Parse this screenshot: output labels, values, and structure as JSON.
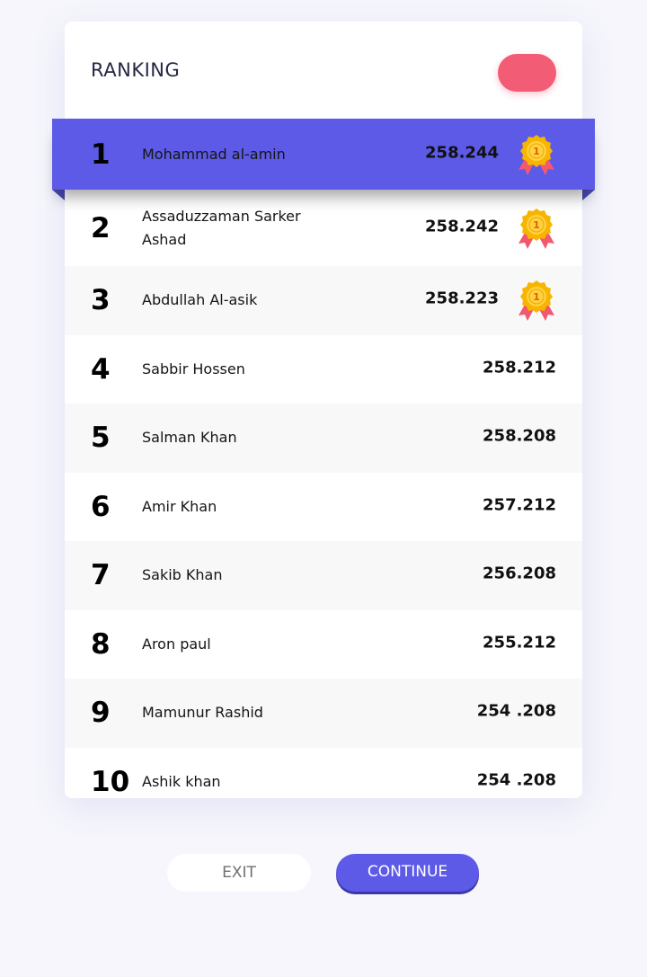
{
  "header": {
    "title": "RANKING"
  },
  "colors": {
    "accent": "#5c5ae6",
    "toggle": "#f25c75",
    "medal_gold": "#f7b500",
    "medal_ribbon": "#f0596e"
  },
  "rankings": [
    {
      "rank": "1",
      "name": "Mohammad al-amin",
      "score": "258.244",
      "medal": "medal-icon"
    },
    {
      "rank": "2",
      "name": "Assaduzzaman Sarker Ashad",
      "score": "258.242",
      "medal": "medal-icon"
    },
    {
      "rank": "3",
      "name": "Abdullah Al-asik",
      "score": "258.223",
      "medal": "medal-icon"
    },
    {
      "rank": "4",
      "name": "Sabbir Hossen",
      "score": "258.212"
    },
    {
      "rank": "5",
      "name": "Salman Khan",
      "score": "258.208"
    },
    {
      "rank": "6",
      "name": "Amir Khan",
      "score": "257.212"
    },
    {
      "rank": "7",
      "name": "Sakib Khan",
      "score": "256.208"
    },
    {
      "rank": "8",
      "name": "Aron paul",
      "score": "255.212"
    },
    {
      "rank": "9",
      "name": "Mamunur Rashid",
      "score": "254 .208"
    },
    {
      "rank": "10",
      "name": "Ashik khan",
      "score": "254 .208"
    }
  ],
  "buttons": {
    "exit": "EXIT",
    "continue": "CONTINUE"
  }
}
